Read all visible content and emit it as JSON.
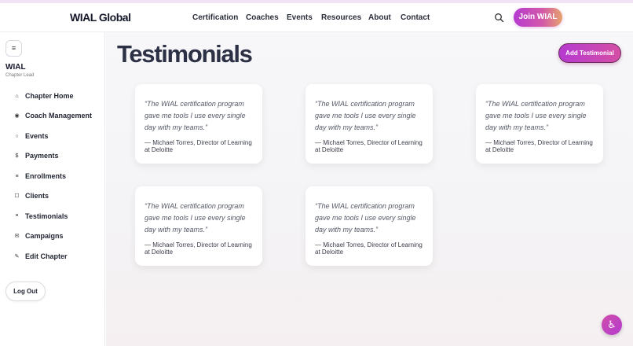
{
  "header": {
    "brand": "WIAL Global",
    "nav": [
      "Certification",
      "Coaches",
      "Events",
      "Resources",
      "About",
      "Contact"
    ],
    "join_label": "Join WIAL"
  },
  "sidebar": {
    "toggle_glyph": "≡",
    "org": "WIAL",
    "role": "Chapter Lead",
    "items": [
      {
        "label": "Chapter Home",
        "icon": "⌂"
      },
      {
        "label": "Coach Management",
        "icon": "◉"
      },
      {
        "label": "Events",
        "icon": "○"
      },
      {
        "label": "Payments",
        "icon": "$"
      },
      {
        "label": "Enrollments",
        "icon": "≡"
      },
      {
        "label": "Clients",
        "icon": "☐"
      },
      {
        "label": "Testimonials",
        "icon": "❝"
      },
      {
        "label": "Campaigns",
        "icon": "✉"
      },
      {
        "label": "Edit Chapter",
        "icon": "✎"
      }
    ],
    "logout_label": "Log Out"
  },
  "main": {
    "title": "Testimonials",
    "add_label": "Add Testimonial",
    "testimonials": [
      {
        "quote": "“The WIAL certification program gave me tools I use every single day with my teams.”",
        "author": "— Michael Torres, Director of Learning at Deloitte"
      },
      {
        "quote": "“The WIAL certification program gave me tools I use every single day with my teams.”",
        "author": "— Michael Torres, Director of Learning at Deloitte"
      },
      {
        "quote": "“The WIAL certification program gave me tools I use every single day with my teams.”",
        "author": "— Michael Torres, Director of Learning at Deloitte"
      },
      {
        "quote": "“The WIAL certification program gave me tools I use every single day with my teams.”",
        "author": "— Michael Torres, Director of Learning at Deloitte"
      },
      {
        "quote": "“The WIAL certification program gave me tools I use every single day with my teams.”",
        "author": "— Michael Torres, Director of Learning at Deloitte"
      }
    ]
  },
  "accessibility": {
    "glyph": "♿"
  }
}
